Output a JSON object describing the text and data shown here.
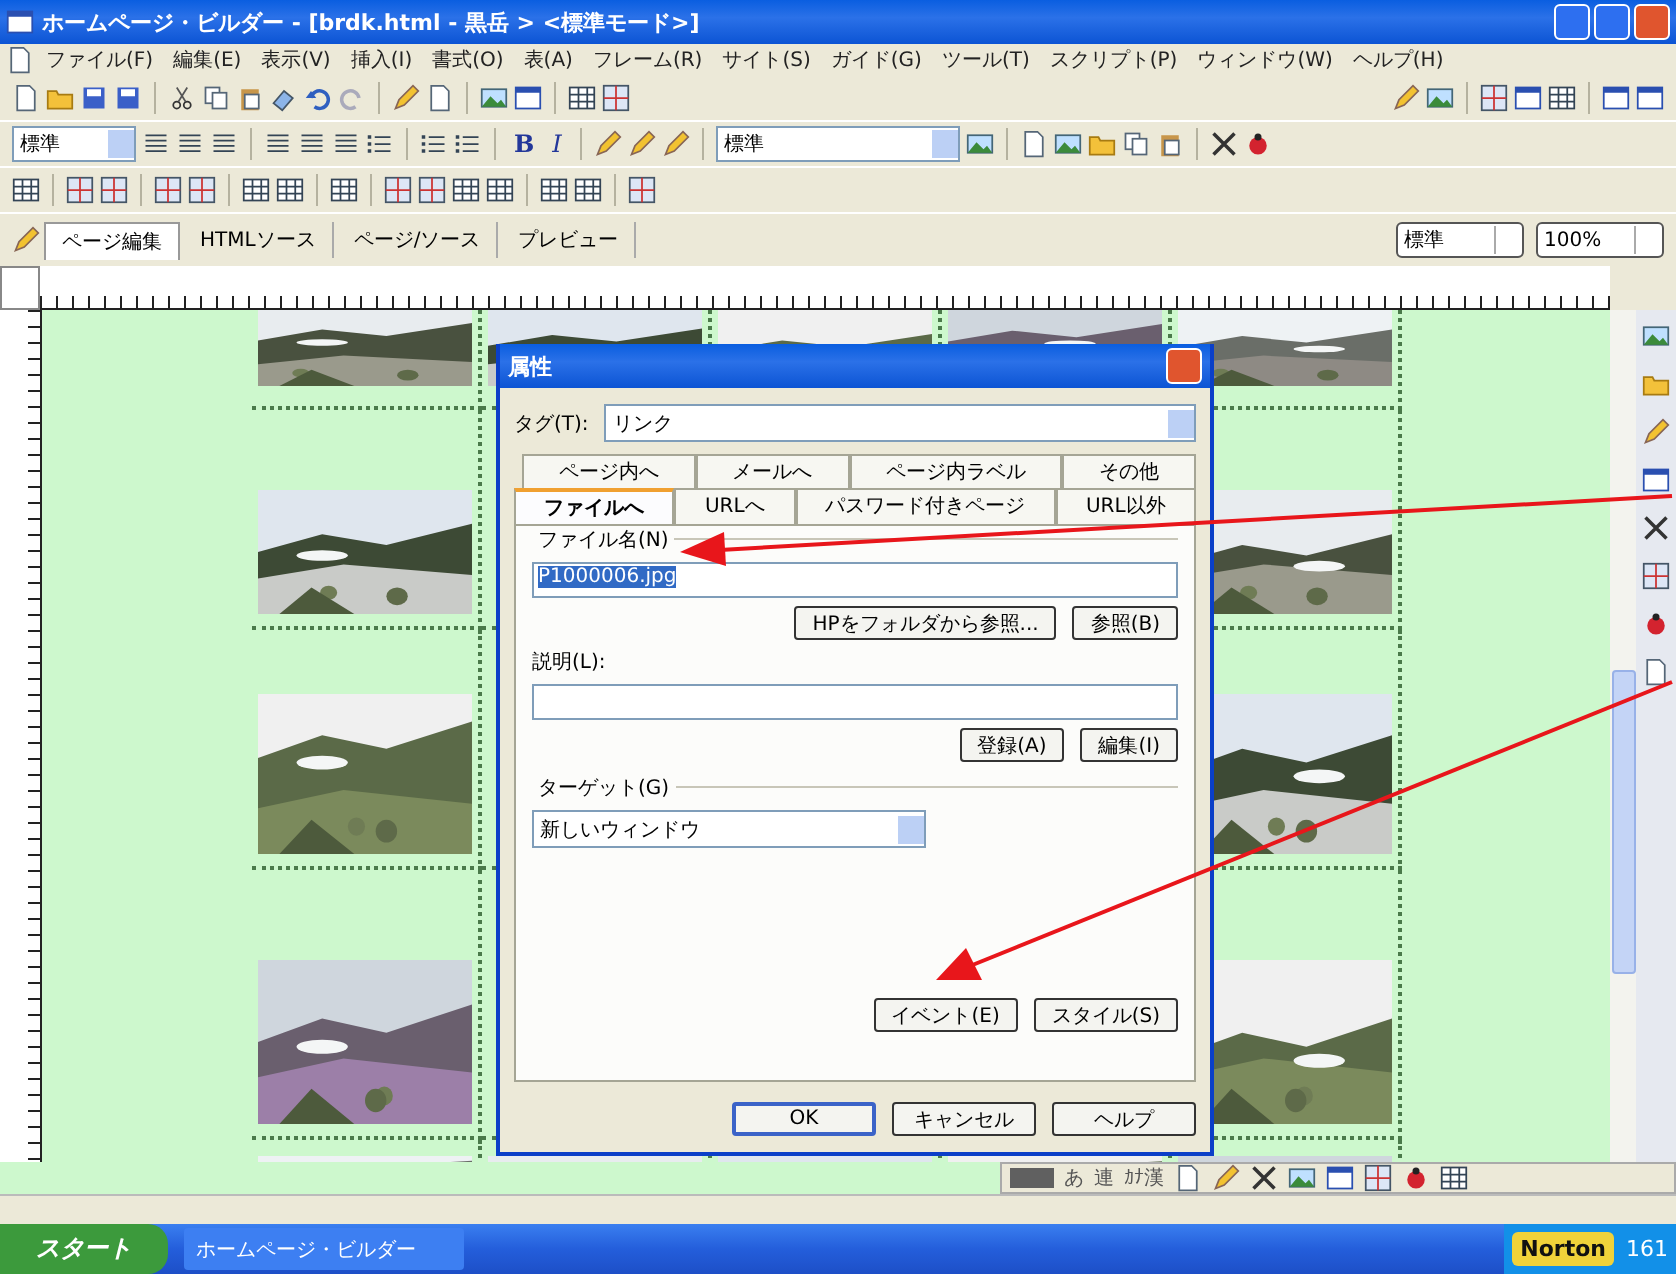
{
  "window": {
    "title": "ホームページ・ビルダー - [brdk.html - 黒岳 > <標準モード>]"
  },
  "menu": [
    "ファイル(F)",
    "編集(E)",
    "表示(V)",
    "挿入(I)",
    "書式(O)",
    "表(A)",
    "フレーム(R)",
    "サイト(S)",
    "ガイド(G)",
    "ツール(T)",
    "スクリプト(P)",
    "ウィンドウ(W)",
    "ヘルプ(H)"
  ],
  "format_bar": {
    "style": "標準",
    "bold": "B",
    "italic": "I",
    "font": "標準"
  },
  "view_tabs": [
    {
      "label": "ページ編集",
      "selected": true
    },
    {
      "label": "HTMLソース",
      "selected": false
    },
    {
      "label": "ページ/ソース",
      "selected": false
    },
    {
      "label": "プレビュー",
      "selected": false
    }
  ],
  "view_selectors": [
    "標準",
    "100%"
  ],
  "dialog": {
    "title": "属性",
    "tag_label": "タグ(T):",
    "tag_value": "リンク",
    "tabs_back": [
      "ページ内へ",
      "メールへ",
      "ページ内ラベル",
      "その他"
    ],
    "tabs_front": [
      {
        "label": "ファイルへ",
        "selected": true
      },
      {
        "label": "URLへ",
        "selected": false
      },
      {
        "label": "パスワード付きページ",
        "selected": false
      },
      {
        "label": "URL以外",
        "selected": false
      }
    ],
    "file_group": "ファイル名(N)",
    "file_value": "P1000006.jpg",
    "folder_button": "HPをフォルダから参照...",
    "browse_button": "参照(B)",
    "description_label": "説明(L):",
    "register_button": "登録(A)",
    "edit_button": "編集(I)",
    "target_label": "ターゲット(G)",
    "target_value": "新しいウィンドウ",
    "event_button": "イベント(E)",
    "style_button": "スタイル(S)",
    "buttons": [
      "OK",
      "キャンセル",
      "ヘルプ"
    ]
  },
  "ime_bar": [
    "あ",
    "連",
    "ｶﾅ漢"
  ],
  "taskbar": {
    "start": "スタート",
    "tasks": [
      "ホームページ・ビルダー"
    ],
    "tray_app": "Norton",
    "clock": "161"
  }
}
